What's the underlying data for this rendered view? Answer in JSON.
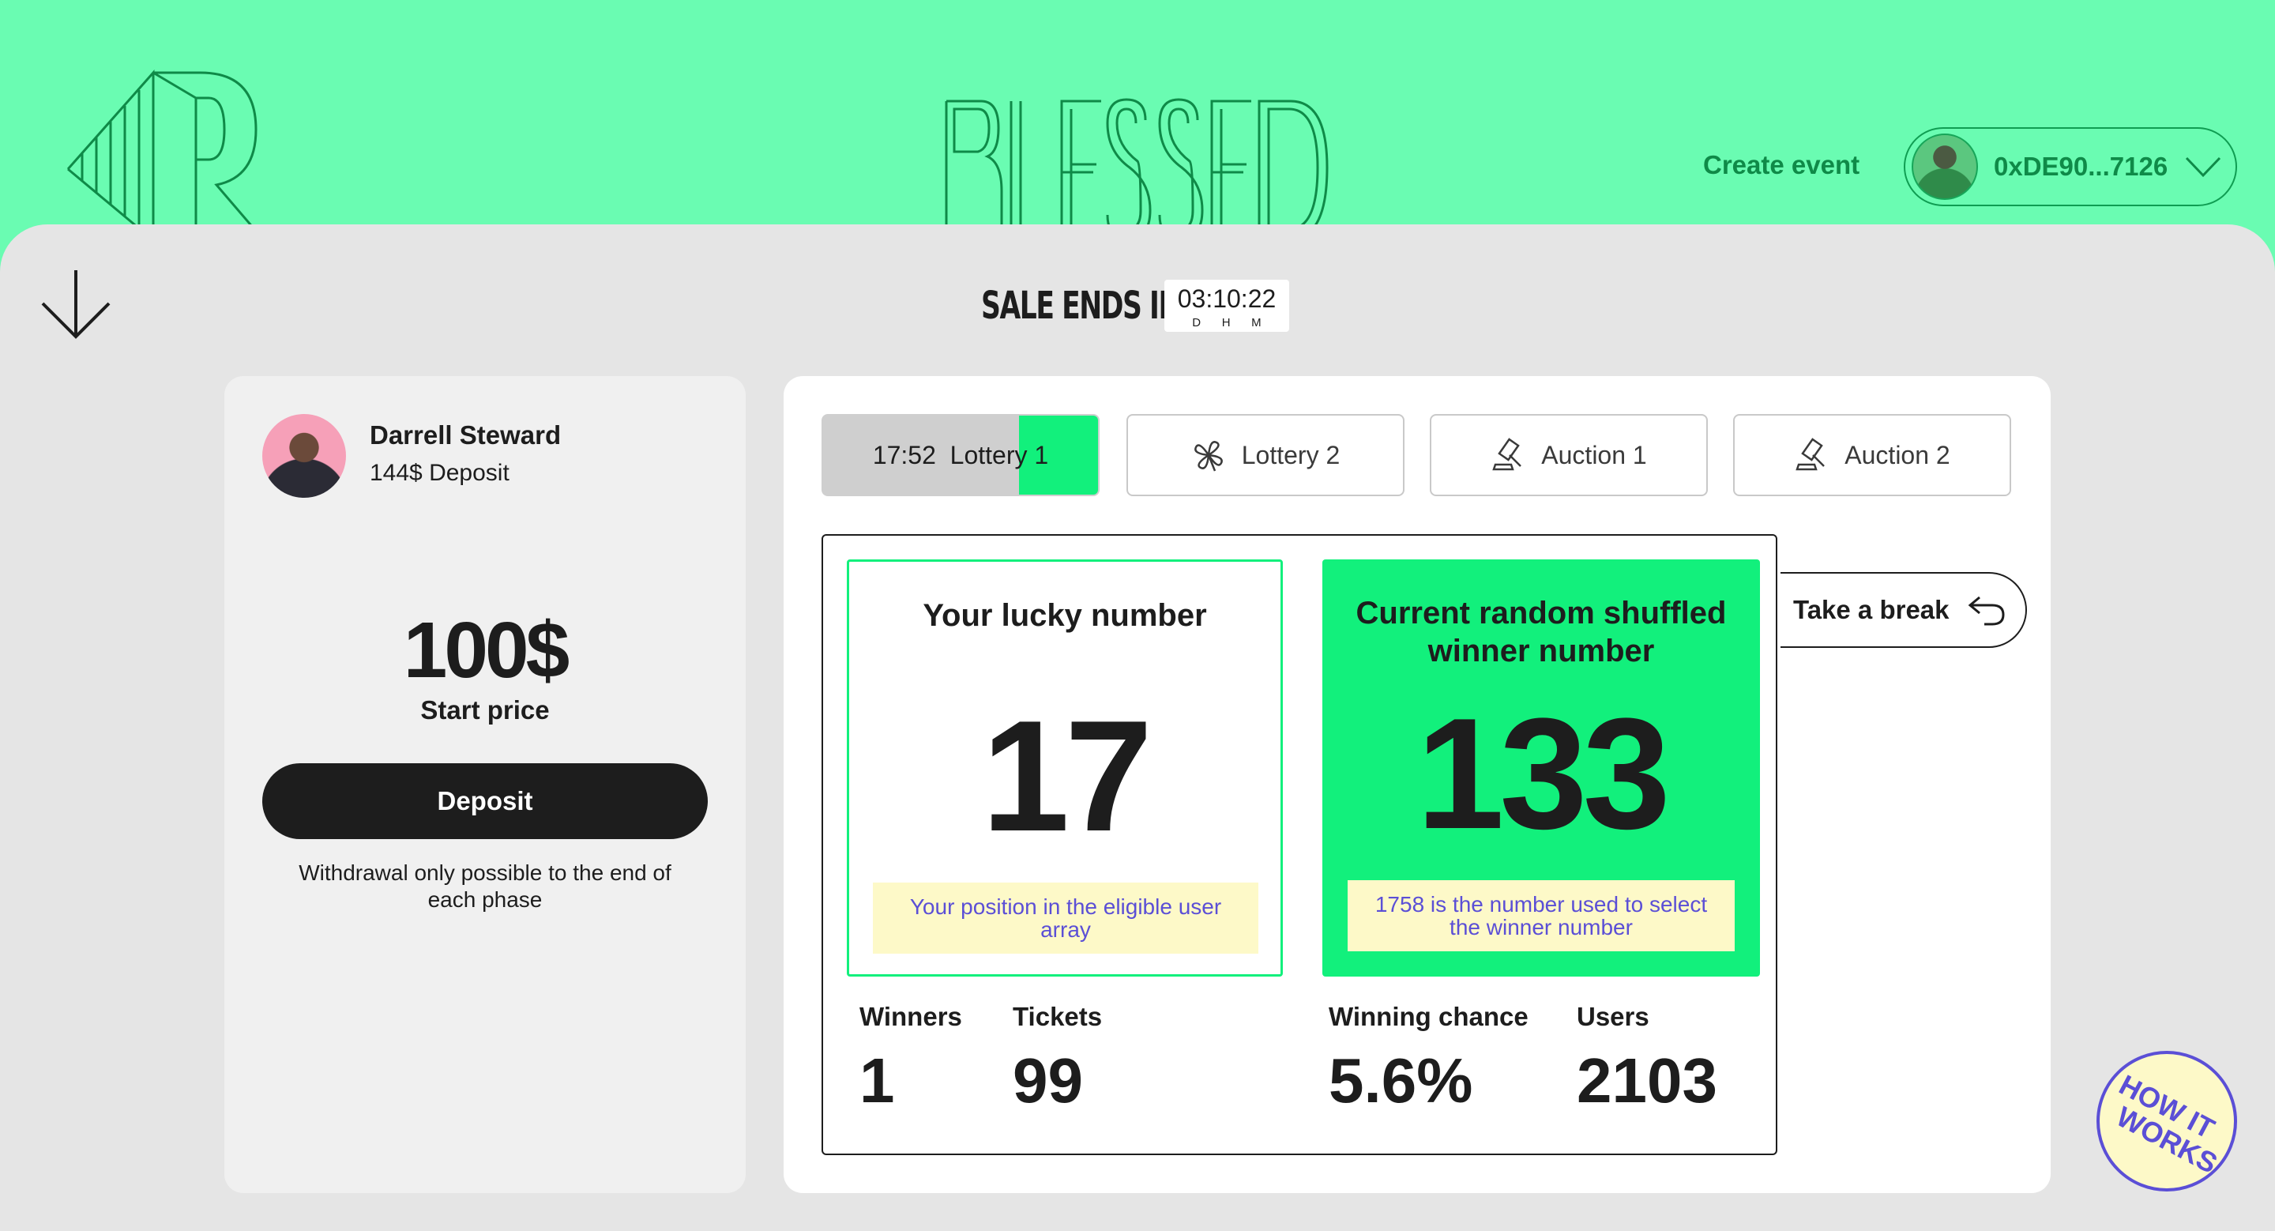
{
  "header": {
    "brand": "BLESSED",
    "create_event_label": "Create event",
    "wallet_address": "0xDE90...7126"
  },
  "sale": {
    "label": "SALE ENDS IN",
    "countdown": "03:10:22",
    "units": [
      "D",
      "H",
      "M"
    ]
  },
  "user": {
    "name": "Darrell Steward",
    "deposit": "144$ Deposit",
    "price": "100$",
    "price_label": "Start price",
    "deposit_button": "Deposit",
    "withdraw_note": "Withdrawal only possible to the end of each phase"
  },
  "tabs": [
    {
      "time": "17:52",
      "label": "Lottery 1",
      "active": true,
      "icon": "none"
    },
    {
      "label": "Lottery 2",
      "icon": "clover-icon"
    },
    {
      "label": "Auction 1",
      "icon": "gavel-icon"
    },
    {
      "label": "Auction 2",
      "icon": "gavel-icon"
    }
  ],
  "lottery": {
    "lucky_title": "Your lucky number",
    "lucky_number": "17",
    "lucky_note": "Your position in the eligible user array",
    "winner_title": "Current random shuffled winner number",
    "winner_number": "133",
    "winner_note": "1758 is the number used to select the winner number",
    "stats": [
      {
        "label": "Winners",
        "value": "1"
      },
      {
        "label": "Tickets",
        "value": "99"
      },
      {
        "label": "Winning chance",
        "value": "5.6%"
      },
      {
        "label": "Users",
        "value": "2103"
      }
    ]
  },
  "break_button": "Take a break",
  "how_it_works": [
    "HOW IT",
    "WORKS"
  ],
  "colors": {
    "header_bg": "#6afcb2",
    "accent_green": "#12f07c",
    "note_bg": "#fdf9c8",
    "note_text": "#5b4fd6",
    "dark": "#1d1d1d"
  }
}
